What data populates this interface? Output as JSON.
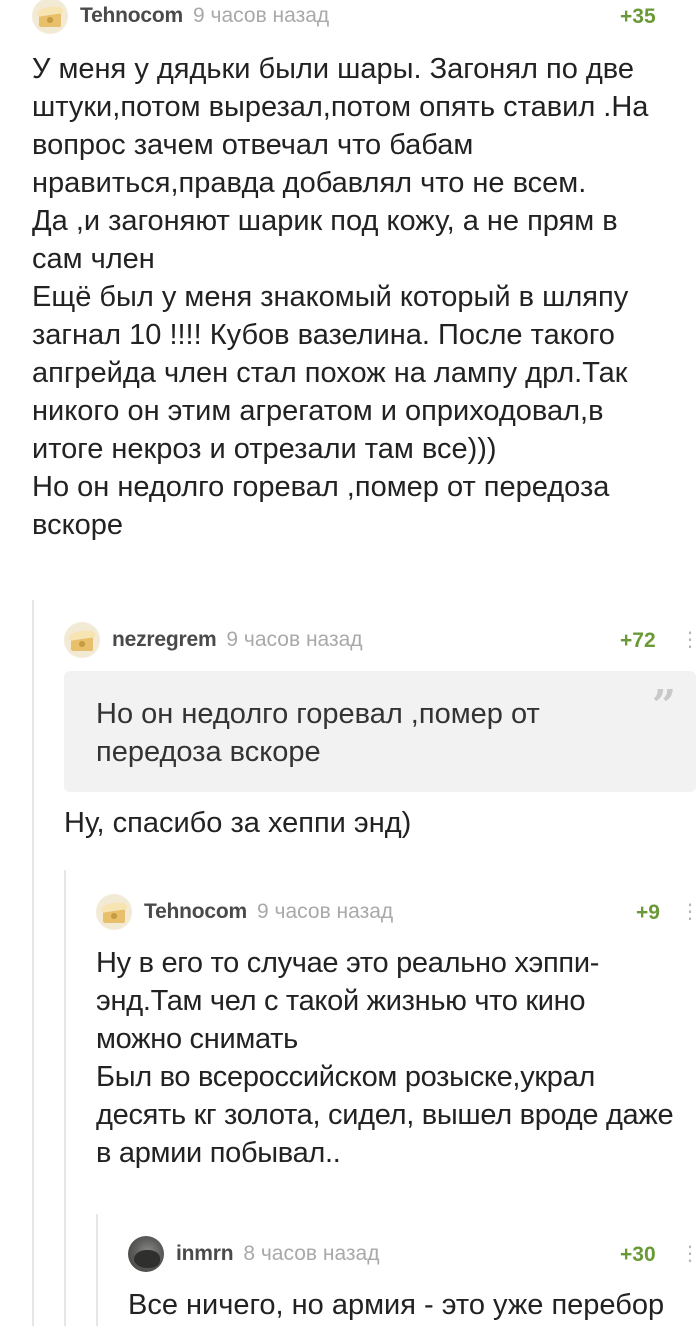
{
  "comments": [
    {
      "username": "Tehnocom",
      "time": "9 часов назад",
      "rating": "+35",
      "text": "У меня у дядьки были шары. Загонял по две\nштуки,потом вырезал,потом опять ставил .На\nвопрос зачем отвечал что бабам\nнравиться,правда добавлял что не всем.\nДа ,и загоняют шарик под кожу, а не прям в\nсам член\nЕщё был у меня знакомый который в шляпу\nзагнал 10 !!!! Кубов вазелина. После такого\nапгрейда член стал похож на лампу дрл.Так\nникого он этим агрегатом и оприходовал,в\nитоге некроз и отрезали там все)))\nНо он недолго горевал ,помер от передоза\nвскоре"
    },
    {
      "username": "nezregrem",
      "time": "9 часов назад",
      "rating": "+72",
      "more": "⋮",
      "quote": "Но он недолго горевал ,помер от\nпередоза вскоре",
      "quote_mark": "”",
      "text": "Ну, спасибо за хеппи энд)"
    },
    {
      "username": "Tehnocom",
      "time": "9 часов назад",
      "rating": "+9",
      "more": "⋮",
      "text": "Ну в его то случае это реально хэппи-\nэнд.Там чел с такой жизнью что кино\nможно снимать\nБыл во всероссийском розыске,украл\nдесять кг золота, сидел, вышел вроде даже\nв армии побывал.."
    },
    {
      "username": "inmrn",
      "time": "8 часов назад",
      "rating": "+30",
      "more": "⋮",
      "text": "Все ничего, но армия - это уже перебор"
    }
  ],
  "colors": {
    "rating": "#6a9a37",
    "username": "#4a4a4a",
    "time": "#a9a9a9",
    "quote_bg": "#f2f2f2",
    "branch_line": "#e6e6e6"
  },
  "icons": {
    "avatar_default": "treasure-chest-avatar",
    "avatar_photo": "photo-avatar",
    "more": "vertical-dots-icon",
    "quote": "quote-icon"
  }
}
